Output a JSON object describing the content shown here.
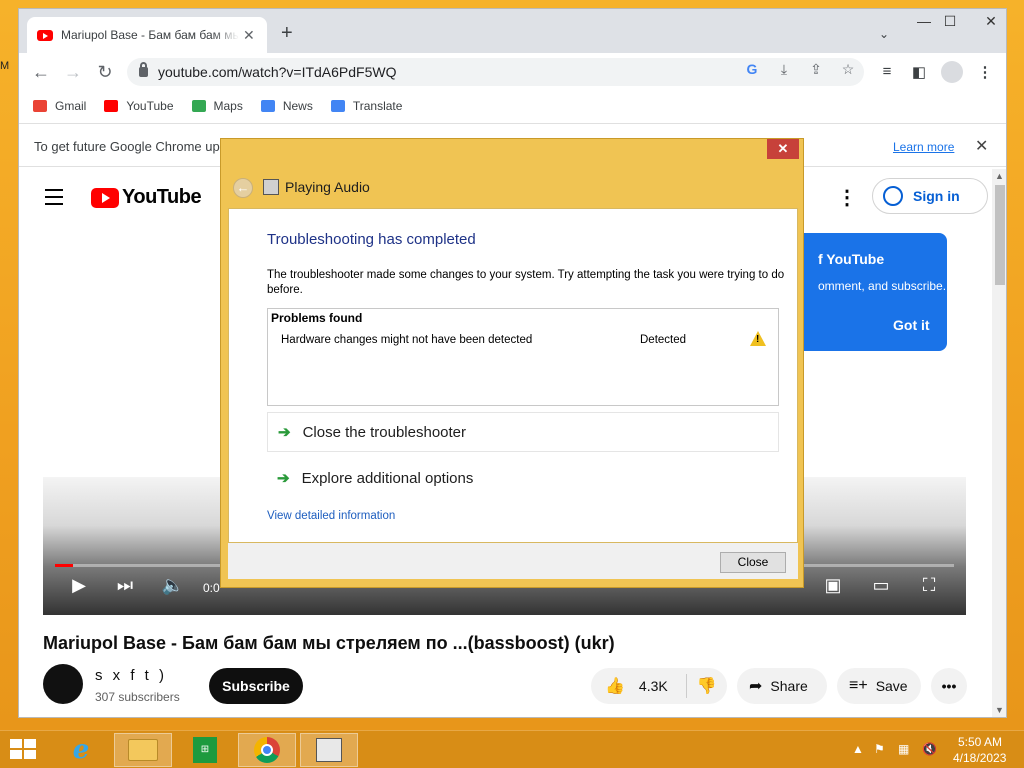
{
  "desktop": {
    "ghost_text": "M"
  },
  "chrome": {
    "tab_title": "Mariupol Base - Бам бам бам мы стреляем по ...(bassboost) (ukr) - YouTube",
    "tab_close": "✕",
    "new_tab": "+",
    "tab_search": "⌄",
    "window": {
      "minimize": "—",
      "maximize": "☐",
      "close": "✕"
    },
    "nav": {
      "back": "←",
      "forward": "→",
      "reload": "↻"
    },
    "url": "youtube.com/watch?v=ITdA6PdF5WQ",
    "bookmarks": [
      {
        "label": "Gmail",
        "color": "#ea4335"
      },
      {
        "label": "YouTube",
        "color": "#ff0000"
      },
      {
        "label": "Maps",
        "color": "#34a853"
      },
      {
        "label": "News",
        "color": "#4285f4"
      },
      {
        "label": "Translate",
        "color": "#4285f4"
      }
    ],
    "infobar": {
      "text": "To get future Google Chrome up",
      "learn_more": "Learn more",
      "close": "✕"
    }
  },
  "youtube": {
    "logo_text": "YouTube",
    "more": "⋮",
    "sign_in": "Sign in",
    "popup": {
      "title": "f YouTube",
      "body": "omment, and subscribe.",
      "button": "Got it"
    },
    "player": {
      "time": "0:0",
      "progress_fraction": 0.02
    },
    "video_title": "Mariupol Base - Бам бам бам мы стреляем по ...(bassboost) (ukr)",
    "channel_name": "s x f t )",
    "subscribers": "307 subscribers",
    "subscribe": "Subscribe",
    "likes": "4.3K",
    "share": "Share",
    "save": "Save",
    "more_actions": "•••"
  },
  "dialog": {
    "close": "✕",
    "back": "←",
    "app_title": "Playing Audio",
    "heading": "Troubleshooting has completed",
    "description": "The troubleshooter made some changes to your system. Try attempting the task you were trying to do before.",
    "problems_header": "Problems found",
    "problem": {
      "description": "Hardware changes might not have been detected",
      "status": "Detected"
    },
    "options": [
      {
        "label": "Close the troubleshooter"
      },
      {
        "label": "Explore additional options"
      }
    ],
    "details_link": "View detailed information",
    "footer_button": "Close"
  },
  "taskbar": {
    "clock_time": "5:50 AM",
    "clock_date": "4/18/2023"
  }
}
